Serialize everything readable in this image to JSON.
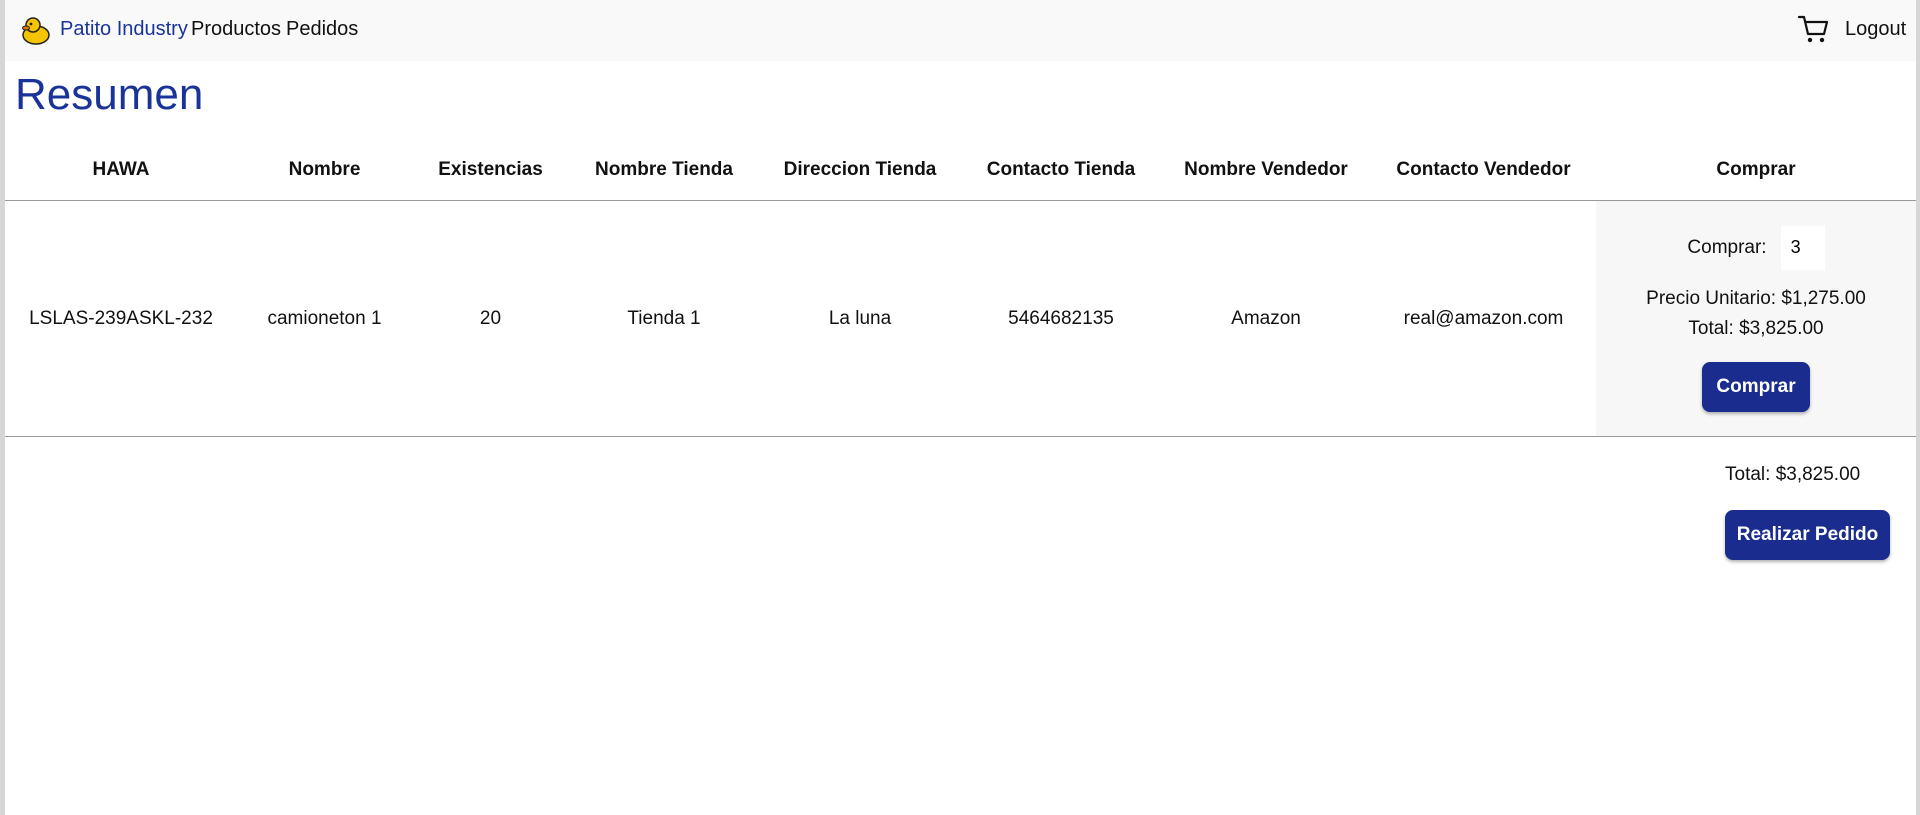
{
  "nav": {
    "brand": "Patito Industry",
    "links": [
      "Productos",
      "Pedidos"
    ],
    "logout": "Logout",
    "brand_icon": "duck-icon",
    "cart_icon": "cart-icon"
  },
  "page": {
    "title": "Resumen"
  },
  "table": {
    "headers": [
      "HAWA",
      "Nombre",
      "Existencias",
      "Nombre Tienda",
      "Direccion Tienda",
      "Contacto Tienda",
      "Nombre Vendedor",
      "Contacto Vendedor",
      "Comprar"
    ],
    "rows": [
      {
        "hawa": "LSLAS-239ASKL-232",
        "nombre": "camioneton 1",
        "existencias": "20",
        "nombre_tienda": "Tienda 1",
        "direccion_tienda": "La luna",
        "contacto_tienda": "5464682135",
        "nombre_vendedor": "Amazon",
        "contacto_vendedor": "real@amazon.com",
        "comprar_label": "Comprar:",
        "cantidad": "3",
        "precio_unitario": "Precio Unitario: $1,275.00",
        "total": "Total: $3,825.00",
        "button": "Comprar"
      }
    ]
  },
  "summary": {
    "total": "Total: $3,825.00",
    "button": "Realizar Pedido"
  },
  "colors": {
    "primary": "#1a2d8f",
    "brand_text": "#1a3399"
  }
}
